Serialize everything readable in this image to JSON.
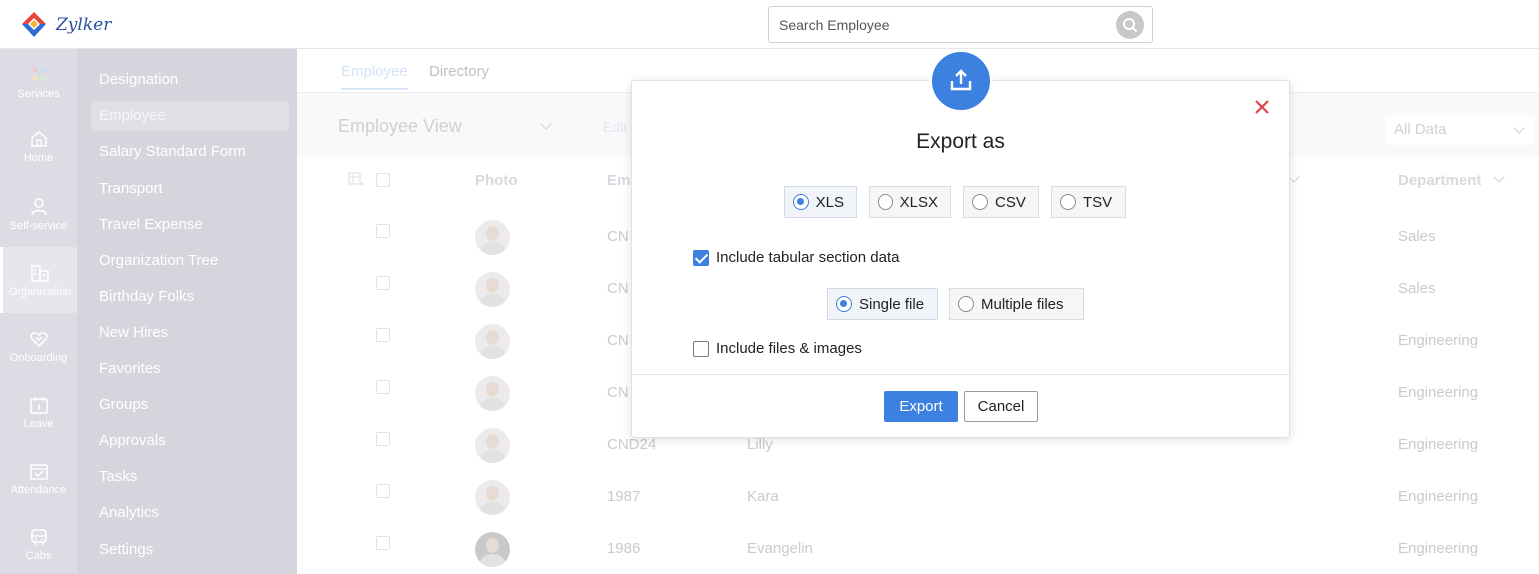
{
  "brand": {
    "name": "Zylker",
    "accent": "#3d81e0"
  },
  "search": {
    "placeholder": "Search Employee",
    "icon": "search-icon"
  },
  "rail": [
    {
      "label": "Services",
      "icon": "services-dots-icon"
    },
    {
      "label": "Home",
      "icon": "home-icon"
    },
    {
      "label": "Self-service",
      "icon": "person-icon"
    },
    {
      "label": "Organization",
      "icon": "organization-icon",
      "active": true
    },
    {
      "label": "Onboarding",
      "icon": "onboarding-icon"
    },
    {
      "label": "Leave",
      "icon": "leave-icon"
    },
    {
      "label": "Attendance",
      "icon": "attendance-icon"
    },
    {
      "label": "Cabs",
      "icon": "cab-icon"
    }
  ],
  "subnav": [
    "Designation",
    "Employee",
    "Salary Standard Form",
    "Transport",
    "Travel Expense",
    "Organization Tree",
    "Birthday Folks",
    "New Hires",
    "Favorites",
    "Groups",
    "Approvals",
    "Tasks",
    "Analytics",
    "Settings"
  ],
  "tabs": [
    "Employee",
    "Directory"
  ],
  "filters": {
    "view": "Employee View",
    "edit": "Edit",
    "all_data": "All Data"
  },
  "table": {
    "headers": {
      "photo": "Photo",
      "id": "Em",
      "department": "Department"
    },
    "rows": [
      {
        "id": "CN",
        "name": "",
        "department": "Sales"
      },
      {
        "id": "CN",
        "name": "",
        "department": "Sales"
      },
      {
        "id": "CN",
        "name": "",
        "department": "Engineering"
      },
      {
        "id": "CN",
        "name": "",
        "department": "Engineering"
      },
      {
        "id": "CND24",
        "name": "Lilly",
        "department": "Engineering"
      },
      {
        "id": "1987",
        "name": "Kara",
        "department": "Engineering"
      },
      {
        "id": "1986",
        "name": "Evangelin",
        "department": "Engineering"
      }
    ]
  },
  "modal": {
    "title": "Export as",
    "icon": "upload-icon",
    "formats": [
      {
        "label": "XLS",
        "selected": true
      },
      {
        "label": "XLSX",
        "selected": false
      },
      {
        "label": "CSV",
        "selected": false
      },
      {
        "label": "TSV",
        "selected": false
      }
    ],
    "include_tabular": {
      "label": "Include tabular section data",
      "checked": true
    },
    "file_options": [
      {
        "label": "Single file",
        "selected": true
      },
      {
        "label": "Multiple files",
        "selected": false
      }
    ],
    "include_files": {
      "label": "Include files & images",
      "checked": false
    },
    "export_label": "Export",
    "cancel_label": "Cancel"
  }
}
